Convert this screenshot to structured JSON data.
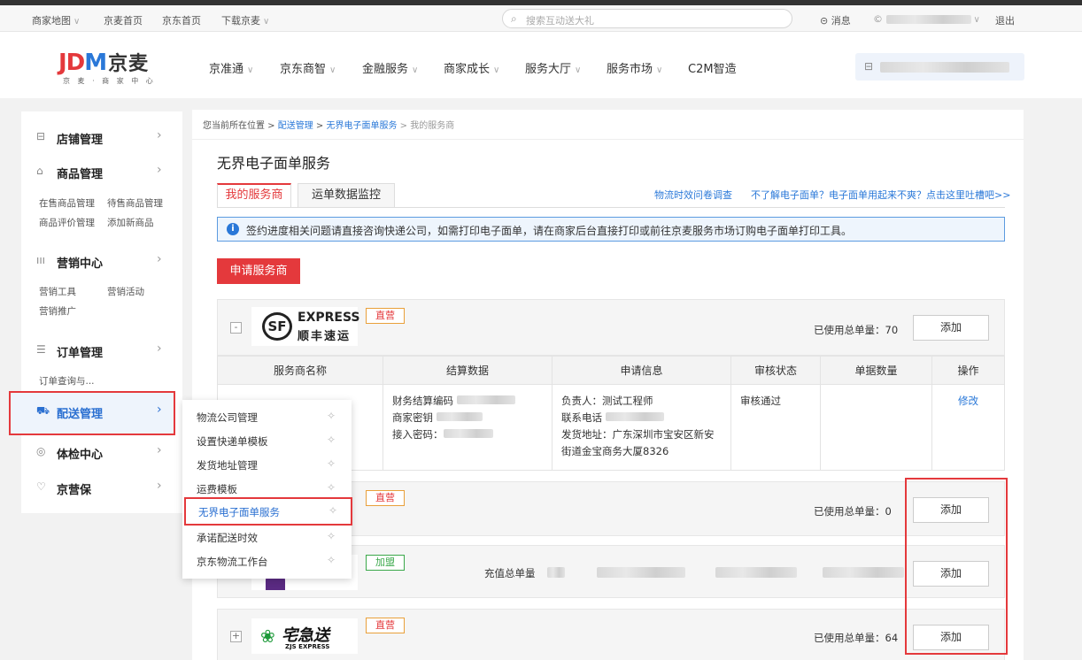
{
  "topbar": {
    "items": [
      "商家地图",
      "京麦首页",
      "京东首页",
      "下载京麦"
    ],
    "search_placeholder": "搜索互动送大礼",
    "message": "消息",
    "logout": "退出"
  },
  "header": {
    "logo_jd": "JD",
    "logo_m": "M",
    "logo_cn": "京麦",
    "logo_sub": "京 麦 · 商 家 中 心",
    "nav": [
      "京准通",
      "京东商智",
      "金融服务",
      "商家成长",
      "服务大厅",
      "服务市场",
      "C2M智造"
    ]
  },
  "sidebar": {
    "sections": [
      {
        "icon": "store-icon",
        "label": "店铺管理",
        "subs": []
      },
      {
        "icon": "bag-icon",
        "label": "商品管理",
        "subs": [
          "在售商品管理",
          "待售商品管理",
          "商品评价管理",
          "添加新商品"
        ]
      },
      {
        "icon": "chart-icon",
        "label": "营销中心",
        "subs": [
          "营销工具",
          "营销活动",
          "营销推广"
        ]
      },
      {
        "icon": "doc-icon",
        "label": "订单管理",
        "subs": [
          "订单查询与..."
        ]
      },
      {
        "icon": "truck-icon",
        "label": "配送管理",
        "subs": []
      },
      {
        "icon": "shield-icon",
        "label": "体检中心",
        "subs": []
      },
      {
        "icon": "heart-icon",
        "label": "京营保",
        "subs": []
      }
    ]
  },
  "main": {
    "breadcrumb": {
      "prefix": "您当前所在位置 > ",
      "l1": "配送管理",
      "sep1": " > ",
      "l2": "无界电子面单服务",
      "sep2": " > ",
      "last": "我的服务商"
    },
    "title": "无界电子面单服务",
    "tabs": [
      "我的服务商",
      "运单数据监控"
    ],
    "links": [
      "物流时效问卷调查",
      "不了解电子面单？电子面单用起来不爽？点击这里吐槽吧>>"
    ],
    "notice": "签约进度相关问题请直接咨询快递公司，如需打印电子面单，请在商家后台直接打印或前往京麦服务市场订购电子面单打印工具。",
    "apply_button": "申请服务商",
    "add_label": "添加",
    "cards": [
      {
        "logo_en": "EXPRESS",
        "logo_cn": "顺丰速运",
        "badge": "直营",
        "used": "已使用总单量：70",
        "toggle": "-"
      },
      {
        "badge": "直营",
        "used": "已使用总单量：0"
      },
      {
        "badge": "加盟",
        "recharge": "充值总单量"
      },
      {
        "logo_cn": "宅急送",
        "logo_en": "ZJS EXPRESS",
        "badge": "直营",
        "used": "已使用总单量：64",
        "toggle": "+"
      }
    ],
    "table": {
      "headers": [
        "服务商名称",
        "结算数据",
        "申请信息",
        "审核状态",
        "单据数量",
        "操作"
      ],
      "row": {
        "settle": [
          "财务结算编码",
          "商家密钥",
          "接入密码："
        ],
        "apply": [
          "负责人：测试工程师",
          "联系电话",
          "发货地址：广东深圳市宝安区新安街道金宝商务大厦8326"
        ],
        "status": "审核通过",
        "action": "修改"
      }
    }
  },
  "dropdown": {
    "items": [
      "物流公司管理",
      "设置快递单模板",
      "发货地址管理",
      "运费模板",
      "无界电子面单服务",
      "承诺配送时效",
      "京东物流工作台"
    ]
  },
  "colors": {
    "brand_red": "#e4393c",
    "link_blue": "#2a78d8",
    "highlight_blue": "#2a6fd1"
  }
}
